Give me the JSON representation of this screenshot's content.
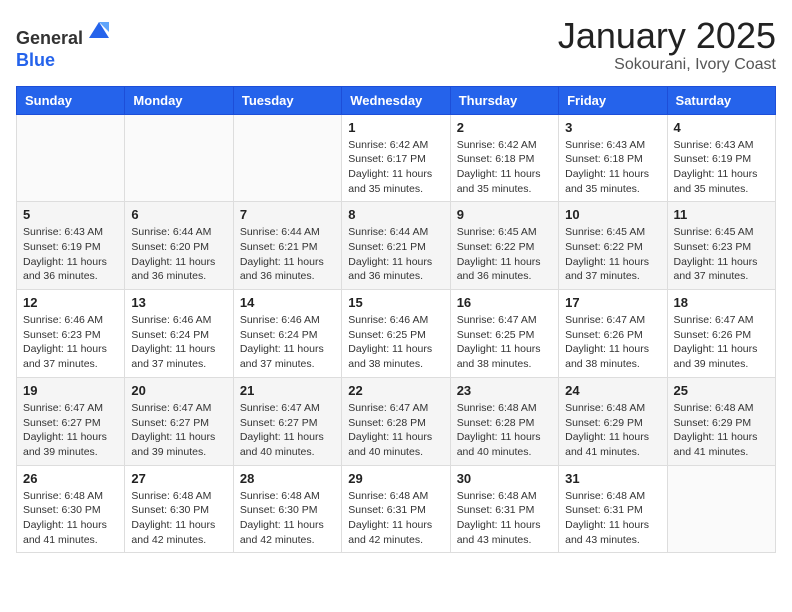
{
  "header": {
    "logo_general": "General",
    "logo_blue": "Blue",
    "month_title": "January 2025",
    "location": "Sokourani, Ivory Coast"
  },
  "days_of_week": [
    "Sunday",
    "Monday",
    "Tuesday",
    "Wednesday",
    "Thursday",
    "Friday",
    "Saturday"
  ],
  "weeks": [
    [
      {
        "day": "",
        "info": ""
      },
      {
        "day": "",
        "info": ""
      },
      {
        "day": "",
        "info": ""
      },
      {
        "day": "1",
        "info": "Sunrise: 6:42 AM\nSunset: 6:17 PM\nDaylight: 11 hours and 35 minutes."
      },
      {
        "day": "2",
        "info": "Sunrise: 6:42 AM\nSunset: 6:18 PM\nDaylight: 11 hours and 35 minutes."
      },
      {
        "day": "3",
        "info": "Sunrise: 6:43 AM\nSunset: 6:18 PM\nDaylight: 11 hours and 35 minutes."
      },
      {
        "day": "4",
        "info": "Sunrise: 6:43 AM\nSunset: 6:19 PM\nDaylight: 11 hours and 35 minutes."
      }
    ],
    [
      {
        "day": "5",
        "info": "Sunrise: 6:43 AM\nSunset: 6:19 PM\nDaylight: 11 hours and 36 minutes."
      },
      {
        "day": "6",
        "info": "Sunrise: 6:44 AM\nSunset: 6:20 PM\nDaylight: 11 hours and 36 minutes."
      },
      {
        "day": "7",
        "info": "Sunrise: 6:44 AM\nSunset: 6:21 PM\nDaylight: 11 hours and 36 minutes."
      },
      {
        "day": "8",
        "info": "Sunrise: 6:44 AM\nSunset: 6:21 PM\nDaylight: 11 hours and 36 minutes."
      },
      {
        "day": "9",
        "info": "Sunrise: 6:45 AM\nSunset: 6:22 PM\nDaylight: 11 hours and 36 minutes."
      },
      {
        "day": "10",
        "info": "Sunrise: 6:45 AM\nSunset: 6:22 PM\nDaylight: 11 hours and 37 minutes."
      },
      {
        "day": "11",
        "info": "Sunrise: 6:45 AM\nSunset: 6:23 PM\nDaylight: 11 hours and 37 minutes."
      }
    ],
    [
      {
        "day": "12",
        "info": "Sunrise: 6:46 AM\nSunset: 6:23 PM\nDaylight: 11 hours and 37 minutes."
      },
      {
        "day": "13",
        "info": "Sunrise: 6:46 AM\nSunset: 6:24 PM\nDaylight: 11 hours and 37 minutes."
      },
      {
        "day": "14",
        "info": "Sunrise: 6:46 AM\nSunset: 6:24 PM\nDaylight: 11 hours and 37 minutes."
      },
      {
        "day": "15",
        "info": "Sunrise: 6:46 AM\nSunset: 6:25 PM\nDaylight: 11 hours and 38 minutes."
      },
      {
        "day": "16",
        "info": "Sunrise: 6:47 AM\nSunset: 6:25 PM\nDaylight: 11 hours and 38 minutes."
      },
      {
        "day": "17",
        "info": "Sunrise: 6:47 AM\nSunset: 6:26 PM\nDaylight: 11 hours and 38 minutes."
      },
      {
        "day": "18",
        "info": "Sunrise: 6:47 AM\nSunset: 6:26 PM\nDaylight: 11 hours and 39 minutes."
      }
    ],
    [
      {
        "day": "19",
        "info": "Sunrise: 6:47 AM\nSunset: 6:27 PM\nDaylight: 11 hours and 39 minutes."
      },
      {
        "day": "20",
        "info": "Sunrise: 6:47 AM\nSunset: 6:27 PM\nDaylight: 11 hours and 39 minutes."
      },
      {
        "day": "21",
        "info": "Sunrise: 6:47 AM\nSunset: 6:27 PM\nDaylight: 11 hours and 40 minutes."
      },
      {
        "day": "22",
        "info": "Sunrise: 6:47 AM\nSunset: 6:28 PM\nDaylight: 11 hours and 40 minutes."
      },
      {
        "day": "23",
        "info": "Sunrise: 6:48 AM\nSunset: 6:28 PM\nDaylight: 11 hours and 40 minutes."
      },
      {
        "day": "24",
        "info": "Sunrise: 6:48 AM\nSunset: 6:29 PM\nDaylight: 11 hours and 41 minutes."
      },
      {
        "day": "25",
        "info": "Sunrise: 6:48 AM\nSunset: 6:29 PM\nDaylight: 11 hours and 41 minutes."
      }
    ],
    [
      {
        "day": "26",
        "info": "Sunrise: 6:48 AM\nSunset: 6:30 PM\nDaylight: 11 hours and 41 minutes."
      },
      {
        "day": "27",
        "info": "Sunrise: 6:48 AM\nSunset: 6:30 PM\nDaylight: 11 hours and 42 minutes."
      },
      {
        "day": "28",
        "info": "Sunrise: 6:48 AM\nSunset: 6:30 PM\nDaylight: 11 hours and 42 minutes."
      },
      {
        "day": "29",
        "info": "Sunrise: 6:48 AM\nSunset: 6:31 PM\nDaylight: 11 hours and 42 minutes."
      },
      {
        "day": "30",
        "info": "Sunrise: 6:48 AM\nSunset: 6:31 PM\nDaylight: 11 hours and 43 minutes."
      },
      {
        "day": "31",
        "info": "Sunrise: 6:48 AM\nSunset: 6:31 PM\nDaylight: 11 hours and 43 minutes."
      },
      {
        "day": "",
        "info": ""
      }
    ]
  ]
}
